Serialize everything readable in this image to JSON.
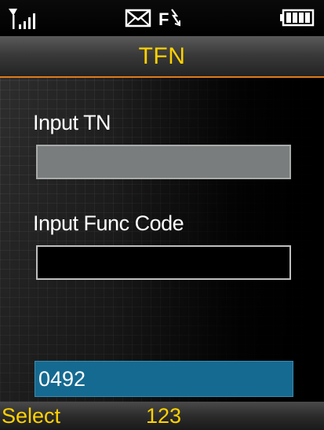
{
  "status_bar": {
    "icons": [
      "signal-strength-icon",
      "message-envelope-icon",
      "forward-call-icon",
      "battery-icon"
    ],
    "forward_letter": "F"
  },
  "title": "TFN",
  "form": {
    "tn_label": "Input TN",
    "tn_value": "",
    "func_label": "Input Func Code",
    "func_value": "",
    "entry_value": "0492"
  },
  "softkeys": {
    "left": "Select",
    "center": "123",
    "right": ""
  },
  "colors": {
    "title_text": "#ffd200",
    "softkey_text": "#ffd200",
    "accent_line": "#e07a1a",
    "entry_bg": "#156a91"
  }
}
